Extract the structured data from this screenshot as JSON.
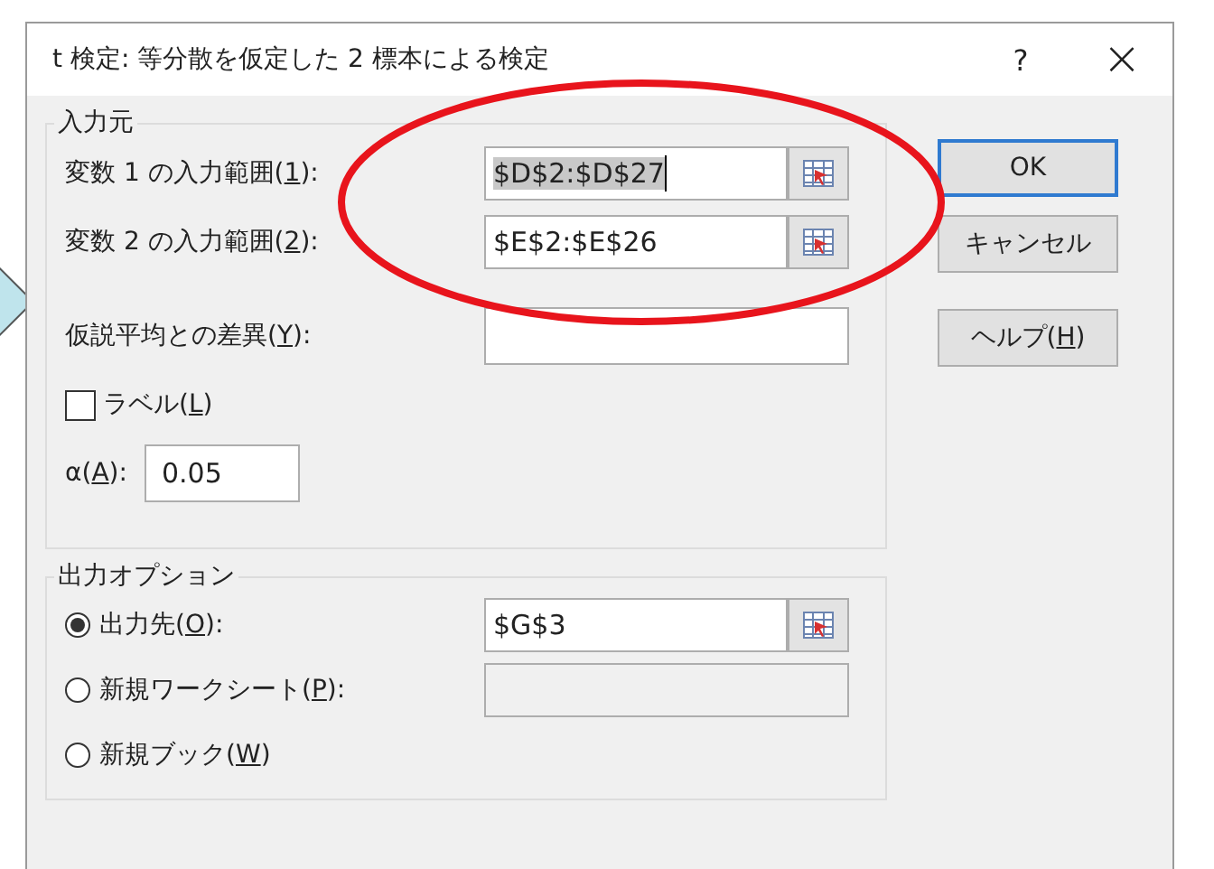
{
  "window": {
    "title": "t 検定: 等分散を仮定した 2 標本による検定",
    "help": "?",
    "close": "×"
  },
  "input_group": {
    "title": "入力元",
    "ranges": [
      {
        "prefix": "変数 1 の入力範囲(",
        "key": "1",
        "suffix": "):",
        "value": "$D$2:$D$27",
        "selected": true
      },
      {
        "prefix": "変数 2 の入力範囲(",
        "key": "2",
        "suffix": "):",
        "value": "$E$2:$E$26",
        "selected": false
      }
    ],
    "difference": {
      "prefix": "仮説平均との差異(",
      "key": "Y",
      "suffix": "):"
    },
    "labels": {
      "prefix": "ラベル(",
      "key": "L",
      "suffix": ")",
      "checked": false
    },
    "alpha": {
      "prefix": "α(",
      "key": "A",
      "suffix": "):",
      "value": "0.05"
    }
  },
  "output_group": {
    "title": "出力オプション",
    "options": [
      {
        "prefix": "出力先(",
        "key": "O",
        "suffix": "):",
        "selected": true,
        "value": "$G$3",
        "disabled": false,
        "kind": "range"
      },
      {
        "prefix": "新規ワークシート(",
        "key": "P",
        "suffix": "):",
        "selected": false,
        "disabled": true,
        "kind": "text"
      },
      {
        "prefix": "新規ブック(",
        "key": "W",
        "suffix": ")",
        "selected": false,
        "kind": "none"
      }
    ]
  },
  "buttons": [
    {
      "label": "OK",
      "default": true
    },
    {
      "label": "キャンセル",
      "default": false
    },
    {
      "prefix": "ヘルプ(",
      "key": "H",
      "suffix": ")",
      "default": false
    }
  ]
}
